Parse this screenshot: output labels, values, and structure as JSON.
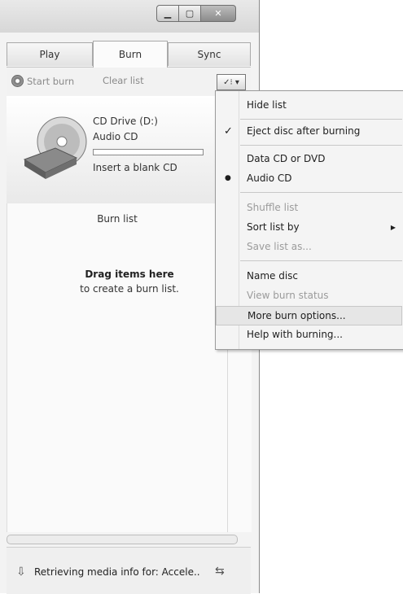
{
  "tabs": [
    "Play",
    "Burn",
    "Sync"
  ],
  "toolbar": {
    "start_burn": "Start burn",
    "clear_list": "Clear list",
    "options_icon": "list-options-icon"
  },
  "drive": {
    "name": "CD Drive (D:)",
    "type": "Audio CD",
    "progress_fraction": 0,
    "hint": "Insert a blank CD"
  },
  "burn_list": {
    "title": "Burn list",
    "drag_title": "Drag items here",
    "drag_sub": "to create a burn list."
  },
  "status": {
    "text": "Retrieving media info for: Accele.."
  },
  "menu": {
    "hide_list": "Hide list",
    "eject": "Eject disc after burning",
    "data_cd": "Data CD or DVD",
    "audio_cd": "Audio CD",
    "shuffle": "Shuffle list",
    "sort": "Sort list by",
    "save_as": "Save list as...",
    "name_disc": "Name disc",
    "view_status": "View burn status",
    "more_options": "More burn options...",
    "help": "Help with burning..."
  },
  "colors": {
    "window_bg": "#f3f3f3",
    "menu_bg": "#f4f4f4",
    "highlight": "#e6e6e6",
    "disabled_text": "#9b9b9b"
  }
}
